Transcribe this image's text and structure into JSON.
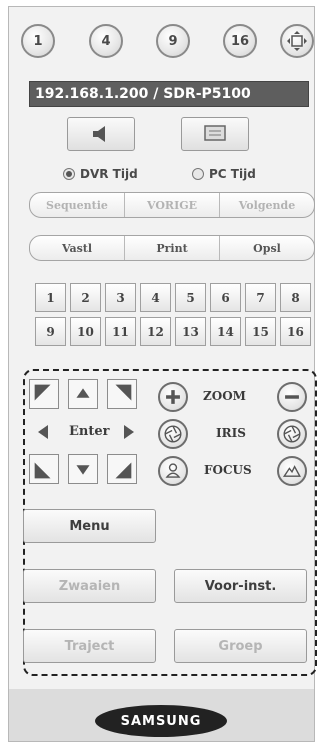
{
  "top_views": [
    "1",
    "4",
    "9",
    "16"
  ],
  "address": "192.168.1.200 / SDR-P5100",
  "audio_icon": "speaker-icon",
  "monitor_icon": "monitor-icon",
  "time_options": {
    "dvr": "DVR Tijd",
    "pc": "PC Tijd",
    "selected": "DVR Tijd"
  },
  "playback": {
    "sequence": "Sequentie",
    "previous": "VORIGE",
    "next": "Volgende"
  },
  "actions": {
    "freeze": "Vastl",
    "print": "Print",
    "save": "Opsl"
  },
  "channels": [
    "1",
    "2",
    "3",
    "4",
    "5",
    "6",
    "7",
    "8",
    "9",
    "10",
    "11",
    "12",
    "13",
    "14",
    "15",
    "16"
  ],
  "ptz": {
    "enter": "Enter",
    "zoom": "ZOOM",
    "iris": "IRIS",
    "focus": "FOCUS",
    "menu": "Menu",
    "swing": "Zwaaien",
    "preset": "Voor-inst.",
    "trace": "Traject",
    "group": "Groep"
  },
  "brand": "SAMSUNG",
  "colors": {
    "address_bg": "#5e5e5e",
    "panel_bg": "#f2f2f2",
    "logo_bg": "#222222"
  }
}
